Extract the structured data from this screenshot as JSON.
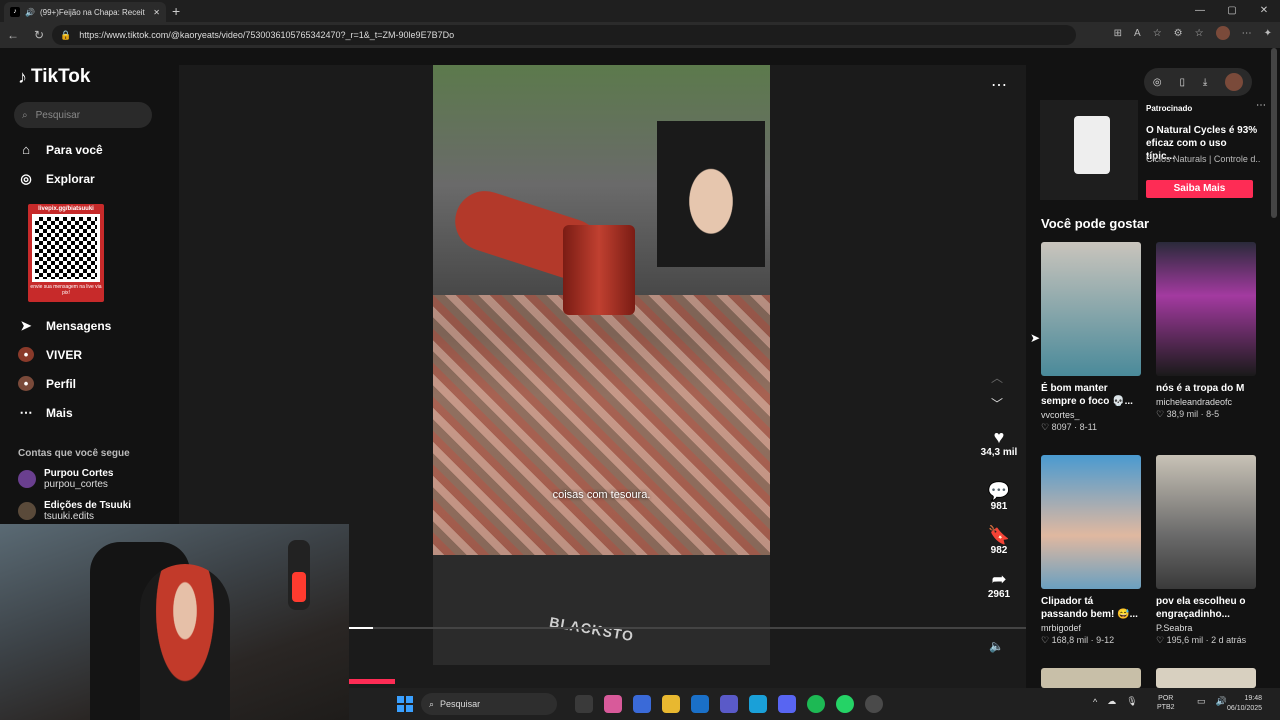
{
  "browser": {
    "tab_title": "(99+)Feijão na Chapa: Receit",
    "tab_close": "✕",
    "new_tab": "+",
    "url": "https://www.tiktok.com/@kaoryeats/video/7530036105765342470?_r=1&_t=ZM-90le9E7B7Do",
    "window": {
      "minimize": "—",
      "maximize": "▢",
      "close": "✕"
    }
  },
  "sidebar": {
    "logo": "TikTok",
    "search_placeholder": "Pesquisar",
    "menu": [
      {
        "label": "Para você",
        "icon": "home-icon"
      },
      {
        "label": "Explorar",
        "icon": "compass-icon"
      },
      {
        "label": "Mensagens",
        "icon": "send-icon"
      },
      {
        "label": "VIVER",
        "icon": "live-icon"
      },
      {
        "label": "Perfil",
        "icon": "profile-icon"
      },
      {
        "label": "Mais",
        "icon": "more-icon"
      }
    ],
    "qr_overlay": {
      "top_text": "livepix.gg/biatsuuki",
      "bottom_text": "envie sua mensagem na live via pix!"
    },
    "following_header": "Contas que você segue",
    "following": [
      {
        "name": "Purpou Cortes",
        "handle": "purpou_cortes"
      },
      {
        "name": "Edições de Tsuuki",
        "handle": "tsuuki.edits"
      }
    ]
  },
  "video": {
    "caption": "coisas com tesoura.",
    "brand_text": "BLACKSTO",
    "actions": {
      "likes": "34,3 mil",
      "comments": "981",
      "saves": "982",
      "shares": "2961"
    }
  },
  "ad": {
    "sponsored": "Patrocinado",
    "title": "O Natural Cycles é 93% eficaz com o uso típic...",
    "subtitle": "Ciclos Naturals | Controle d...",
    "cta": "Saiba Mais"
  },
  "suggestions": {
    "header": "Você pode gostar",
    "cards": [
      {
        "title": "É bom manter sempre o foco 💀...",
        "user": "vvcortes_",
        "likes": "8097",
        "date": "8-11"
      },
      {
        "title": "nós é a tropa do M",
        "user": "micheleandradeofc",
        "likes": "38,9 mil",
        "date": "8-5"
      },
      {
        "title": "Clipador tá passando bem! 😅...",
        "user": "mrbigodef",
        "likes": "168,8 mil",
        "date": "9-12"
      },
      {
        "title": "pov ela escolheu o engraçadinho...",
        "user": "P.Seabra",
        "likes": "195,6 mil",
        "date": "2 d atrás"
      }
    ]
  },
  "taskbar": {
    "search_placeholder": "Pesquisar",
    "lang_top": "POR",
    "lang_bottom": "PTB2",
    "time": "19:48",
    "date": "06/10/2025"
  },
  "colors": {
    "accent": "#fe2c55",
    "background": "#121212"
  }
}
